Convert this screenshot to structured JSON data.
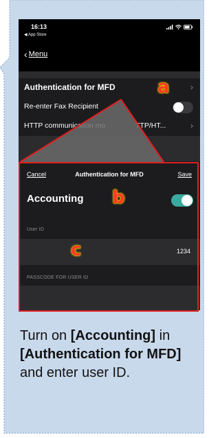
{
  "status_bar": {
    "time": "16:13",
    "back_app": "◀ App Store"
  },
  "nav": {
    "back_label": "Menu"
  },
  "settings_rows": [
    {
      "label": "Authentication for MFD",
      "accessory": "chevron"
    },
    {
      "label": "Re-enter Fax Recipient",
      "accessory": "toggle-off"
    },
    {
      "label": "HTTP communication mo",
      "suffix": "TTP/HT...",
      "accessory": "chevron"
    }
  ],
  "modal": {
    "cancel_label": "Cancel",
    "title": "Authentication for MFD",
    "save_label": "Save",
    "accounting_label": "Accounting",
    "accounting_enabled": true,
    "user_id_header": "User ID",
    "user_id_value": "1234",
    "passcode_header": "PASSCODE FOR USER ID"
  },
  "markers": {
    "a": "a",
    "b": "b",
    "c": "c"
  },
  "caption": {
    "part1": "Turn on ",
    "bold1": "[Accounting]",
    "part2": " in ",
    "bold2": "[Authentication for MFD]",
    "part3": " and enter user ID."
  },
  "colors": {
    "callout_bg": "#c9d9ec",
    "callout_border": "#9fb7d6",
    "highlight_red": "#e02020",
    "toggle_on": "#3aa99f",
    "marker_red": "#ff3b1f",
    "marker_glow": "#ffd600"
  }
}
